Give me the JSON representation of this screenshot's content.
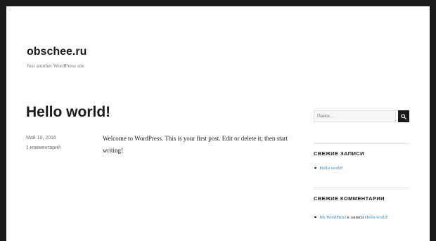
{
  "site": {
    "title": "obschee.ru",
    "description": "Just another WordPress site"
  },
  "post": {
    "title": "Hello world!",
    "date": "Май 10, 2016",
    "comments": "1 комментарий",
    "content": "Welcome to WordPress. This is your first post. Edit or delete it, then start writing!"
  },
  "sidebar": {
    "search": {
      "placeholder": "Поиск…"
    },
    "recent_posts": {
      "title": "СВЕЖИЕ ЗАПИСИ",
      "items": [
        {
          "label": "Hello world!"
        }
      ]
    },
    "recent_comments": {
      "title": "СВЕЖИЕ КОММЕНТАРИИ",
      "items": [
        {
          "author": "Mr WordPress",
          "connector": "к записи",
          "post": "Hello world!"
        }
      ]
    }
  },
  "colors": {
    "background": "#1a1a1a",
    "page": "#ffffff",
    "link": "#2e89c8",
    "meta": "#707070"
  }
}
